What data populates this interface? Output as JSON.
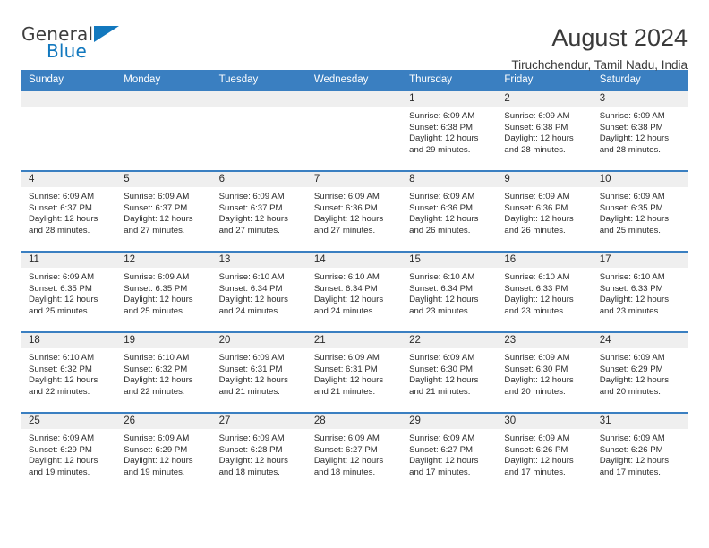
{
  "logo": {
    "word_one": "General",
    "word_two": "Blue",
    "triangle_color": "#1278be"
  },
  "header": {
    "title": "August 2024",
    "location": "Tiruchchendur, Tamil Nadu, India"
  },
  "theme": {
    "header_blue": "#3a7fc1",
    "daynum_band": "#efefef",
    "text": "#2b2b2b"
  },
  "weekdays": [
    "Sunday",
    "Monday",
    "Tuesday",
    "Wednesday",
    "Thursday",
    "Friday",
    "Saturday"
  ],
  "weeks": [
    [
      {
        "day": "",
        "sunrise": "",
        "sunset": "",
        "daylight_line1": "",
        "daylight_line2": ""
      },
      {
        "day": "",
        "sunrise": "",
        "sunset": "",
        "daylight_line1": "",
        "daylight_line2": ""
      },
      {
        "day": "",
        "sunrise": "",
        "sunset": "",
        "daylight_line1": "",
        "daylight_line2": ""
      },
      {
        "day": "",
        "sunrise": "",
        "sunset": "",
        "daylight_line1": "",
        "daylight_line2": ""
      },
      {
        "day": "1",
        "sunrise": "Sunrise: 6:09 AM",
        "sunset": "Sunset: 6:38 PM",
        "daylight_line1": "Daylight: 12 hours",
        "daylight_line2": "and 29 minutes."
      },
      {
        "day": "2",
        "sunrise": "Sunrise: 6:09 AM",
        "sunset": "Sunset: 6:38 PM",
        "daylight_line1": "Daylight: 12 hours",
        "daylight_line2": "and 28 minutes."
      },
      {
        "day": "3",
        "sunrise": "Sunrise: 6:09 AM",
        "sunset": "Sunset: 6:38 PM",
        "daylight_line1": "Daylight: 12 hours",
        "daylight_line2": "and 28 minutes."
      }
    ],
    [
      {
        "day": "4",
        "sunrise": "Sunrise: 6:09 AM",
        "sunset": "Sunset: 6:37 PM",
        "daylight_line1": "Daylight: 12 hours",
        "daylight_line2": "and 28 minutes."
      },
      {
        "day": "5",
        "sunrise": "Sunrise: 6:09 AM",
        "sunset": "Sunset: 6:37 PM",
        "daylight_line1": "Daylight: 12 hours",
        "daylight_line2": "and 27 minutes."
      },
      {
        "day": "6",
        "sunrise": "Sunrise: 6:09 AM",
        "sunset": "Sunset: 6:37 PM",
        "daylight_line1": "Daylight: 12 hours",
        "daylight_line2": "and 27 minutes."
      },
      {
        "day": "7",
        "sunrise": "Sunrise: 6:09 AM",
        "sunset": "Sunset: 6:36 PM",
        "daylight_line1": "Daylight: 12 hours",
        "daylight_line2": "and 27 minutes."
      },
      {
        "day": "8",
        "sunrise": "Sunrise: 6:09 AM",
        "sunset": "Sunset: 6:36 PM",
        "daylight_line1": "Daylight: 12 hours",
        "daylight_line2": "and 26 minutes."
      },
      {
        "day": "9",
        "sunrise": "Sunrise: 6:09 AM",
        "sunset": "Sunset: 6:36 PM",
        "daylight_line1": "Daylight: 12 hours",
        "daylight_line2": "and 26 minutes."
      },
      {
        "day": "10",
        "sunrise": "Sunrise: 6:09 AM",
        "sunset": "Sunset: 6:35 PM",
        "daylight_line1": "Daylight: 12 hours",
        "daylight_line2": "and 25 minutes."
      }
    ],
    [
      {
        "day": "11",
        "sunrise": "Sunrise: 6:09 AM",
        "sunset": "Sunset: 6:35 PM",
        "daylight_line1": "Daylight: 12 hours",
        "daylight_line2": "and 25 minutes."
      },
      {
        "day": "12",
        "sunrise": "Sunrise: 6:09 AM",
        "sunset": "Sunset: 6:35 PM",
        "daylight_line1": "Daylight: 12 hours",
        "daylight_line2": "and 25 minutes."
      },
      {
        "day": "13",
        "sunrise": "Sunrise: 6:10 AM",
        "sunset": "Sunset: 6:34 PM",
        "daylight_line1": "Daylight: 12 hours",
        "daylight_line2": "and 24 minutes."
      },
      {
        "day": "14",
        "sunrise": "Sunrise: 6:10 AM",
        "sunset": "Sunset: 6:34 PM",
        "daylight_line1": "Daylight: 12 hours",
        "daylight_line2": "and 24 minutes."
      },
      {
        "day": "15",
        "sunrise": "Sunrise: 6:10 AM",
        "sunset": "Sunset: 6:34 PM",
        "daylight_line1": "Daylight: 12 hours",
        "daylight_line2": "and 23 minutes."
      },
      {
        "day": "16",
        "sunrise": "Sunrise: 6:10 AM",
        "sunset": "Sunset: 6:33 PM",
        "daylight_line1": "Daylight: 12 hours",
        "daylight_line2": "and 23 minutes."
      },
      {
        "day": "17",
        "sunrise": "Sunrise: 6:10 AM",
        "sunset": "Sunset: 6:33 PM",
        "daylight_line1": "Daylight: 12 hours",
        "daylight_line2": "and 23 minutes."
      }
    ],
    [
      {
        "day": "18",
        "sunrise": "Sunrise: 6:10 AM",
        "sunset": "Sunset: 6:32 PM",
        "daylight_line1": "Daylight: 12 hours",
        "daylight_line2": "and 22 minutes."
      },
      {
        "day": "19",
        "sunrise": "Sunrise: 6:10 AM",
        "sunset": "Sunset: 6:32 PM",
        "daylight_line1": "Daylight: 12 hours",
        "daylight_line2": "and 22 minutes."
      },
      {
        "day": "20",
        "sunrise": "Sunrise: 6:09 AM",
        "sunset": "Sunset: 6:31 PM",
        "daylight_line1": "Daylight: 12 hours",
        "daylight_line2": "and 21 minutes."
      },
      {
        "day": "21",
        "sunrise": "Sunrise: 6:09 AM",
        "sunset": "Sunset: 6:31 PM",
        "daylight_line1": "Daylight: 12 hours",
        "daylight_line2": "and 21 minutes."
      },
      {
        "day": "22",
        "sunrise": "Sunrise: 6:09 AM",
        "sunset": "Sunset: 6:30 PM",
        "daylight_line1": "Daylight: 12 hours",
        "daylight_line2": "and 21 minutes."
      },
      {
        "day": "23",
        "sunrise": "Sunrise: 6:09 AM",
        "sunset": "Sunset: 6:30 PM",
        "daylight_line1": "Daylight: 12 hours",
        "daylight_line2": "and 20 minutes."
      },
      {
        "day": "24",
        "sunrise": "Sunrise: 6:09 AM",
        "sunset": "Sunset: 6:29 PM",
        "daylight_line1": "Daylight: 12 hours",
        "daylight_line2": "and 20 minutes."
      }
    ],
    [
      {
        "day": "25",
        "sunrise": "Sunrise: 6:09 AM",
        "sunset": "Sunset: 6:29 PM",
        "daylight_line1": "Daylight: 12 hours",
        "daylight_line2": "and 19 minutes."
      },
      {
        "day": "26",
        "sunrise": "Sunrise: 6:09 AM",
        "sunset": "Sunset: 6:29 PM",
        "daylight_line1": "Daylight: 12 hours",
        "daylight_line2": "and 19 minutes."
      },
      {
        "day": "27",
        "sunrise": "Sunrise: 6:09 AM",
        "sunset": "Sunset: 6:28 PM",
        "daylight_line1": "Daylight: 12 hours",
        "daylight_line2": "and 18 minutes."
      },
      {
        "day": "28",
        "sunrise": "Sunrise: 6:09 AM",
        "sunset": "Sunset: 6:27 PM",
        "daylight_line1": "Daylight: 12 hours",
        "daylight_line2": "and 18 minutes."
      },
      {
        "day": "29",
        "sunrise": "Sunrise: 6:09 AM",
        "sunset": "Sunset: 6:27 PM",
        "daylight_line1": "Daylight: 12 hours",
        "daylight_line2": "and 17 minutes."
      },
      {
        "day": "30",
        "sunrise": "Sunrise: 6:09 AM",
        "sunset": "Sunset: 6:26 PM",
        "daylight_line1": "Daylight: 12 hours",
        "daylight_line2": "and 17 minutes."
      },
      {
        "day": "31",
        "sunrise": "Sunrise: 6:09 AM",
        "sunset": "Sunset: 6:26 PM",
        "daylight_line1": "Daylight: 12 hours",
        "daylight_line2": "and 17 minutes."
      }
    ]
  ]
}
